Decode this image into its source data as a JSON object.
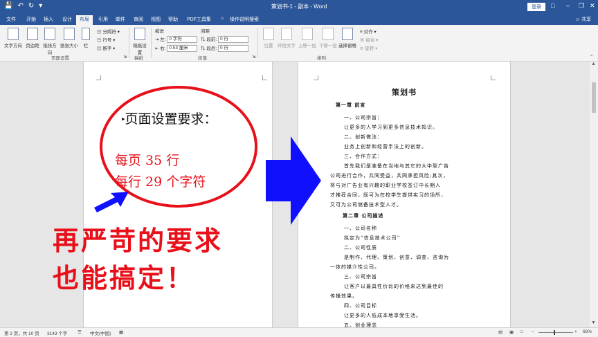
{
  "window": {
    "title": "策划书-1 - 副本 - Word",
    "login_label": "登录",
    "share_label": "共享"
  },
  "qat_icons": [
    "save-icon",
    "undo-icon",
    "redo-icon",
    "customize-icon"
  ],
  "tabs": [
    "文件",
    "开始",
    "插入",
    "设计",
    "布局",
    "引用",
    "邮件",
    "审阅",
    "视图",
    "帮助",
    "PDF工具集"
  ],
  "active_tab": "布局",
  "tell_me": "操作说明搜索",
  "ribbon": {
    "text_direction": "文字方向",
    "margins": "页边距",
    "orientation": "纸张方向",
    "size": "纸张大小",
    "columns": "栏",
    "breaks": "分隔符",
    "line_numbers": "行号",
    "hyphenation": "断字",
    "page_setup_group": "页面设置",
    "draft_paper": "稿纸设置",
    "draft_group": "稿纸",
    "indent_title": "缩进",
    "spacing_title": "间距",
    "indent_left_label": "左:",
    "indent_left_value": "0 字符",
    "indent_right_label": "右:",
    "indent_right_value": "0.53 厘米",
    "space_before_label": "段前:",
    "space_before_value": "0 行",
    "space_after_label": "段后:",
    "space_after_value": "0 行",
    "paragraph_group": "段落",
    "position": "位置",
    "wrap_text": "环绕文字",
    "bring_forward": "上移一层",
    "send_backward": "下移一层",
    "selection_pane": "选择窗格",
    "align": "对齐",
    "group": "组合",
    "rotate": "旋转",
    "arrange_group": "排列"
  },
  "left_page": {
    "heading": "页面设置要求：",
    "req1": "每页 35 行",
    "req2": "每行 29 个字符",
    "callout_line1": "再严苛的要求",
    "callout_line2": "也能搞定！"
  },
  "right_page": {
    "title": "策划书",
    "lines": [
      "第一章  前言",
      "一、公司宗旨：",
      "让更多的人学习到更多信息技术知识。",
      "二、创新做法：",
      "业务上创新和经营手法上的创新。",
      "三、合作方式：",
      "首先我们是准备在当地与其它的大中型广告",
      "公司进行合作，共同受益，共同承担风险;其次，",
      "将与对广告业有兴趣的职业学校签订中长期人",
      "才推荐合同，既可为在校学生提供实习的场所，",
      "又可为公司储备技术型人才。",
      "第二章  公司描述",
      "一、公司名称",
      "拟定为“信息技术公司”",
      "二、公司性质",
      "是制作、代理、策划、创意、调查、咨询为",
      "一体的媒介性公司。",
      "三、公司宗旨",
      "让客户以最具性价比的价格来达到最佳的",
      "传播效果。",
      "四、公司目标",
      "让更多的人低成本地享受生活。",
      "五、创业理念"
    ]
  },
  "status": {
    "page": "第 2 页，共 10 页",
    "words": "3143 个字",
    "language": "中文(中国)",
    "zoom": "68%"
  },
  "colors": {
    "brand": "#2b579a",
    "red": "#e8101a",
    "blue_arrow": "#1010ff"
  }
}
